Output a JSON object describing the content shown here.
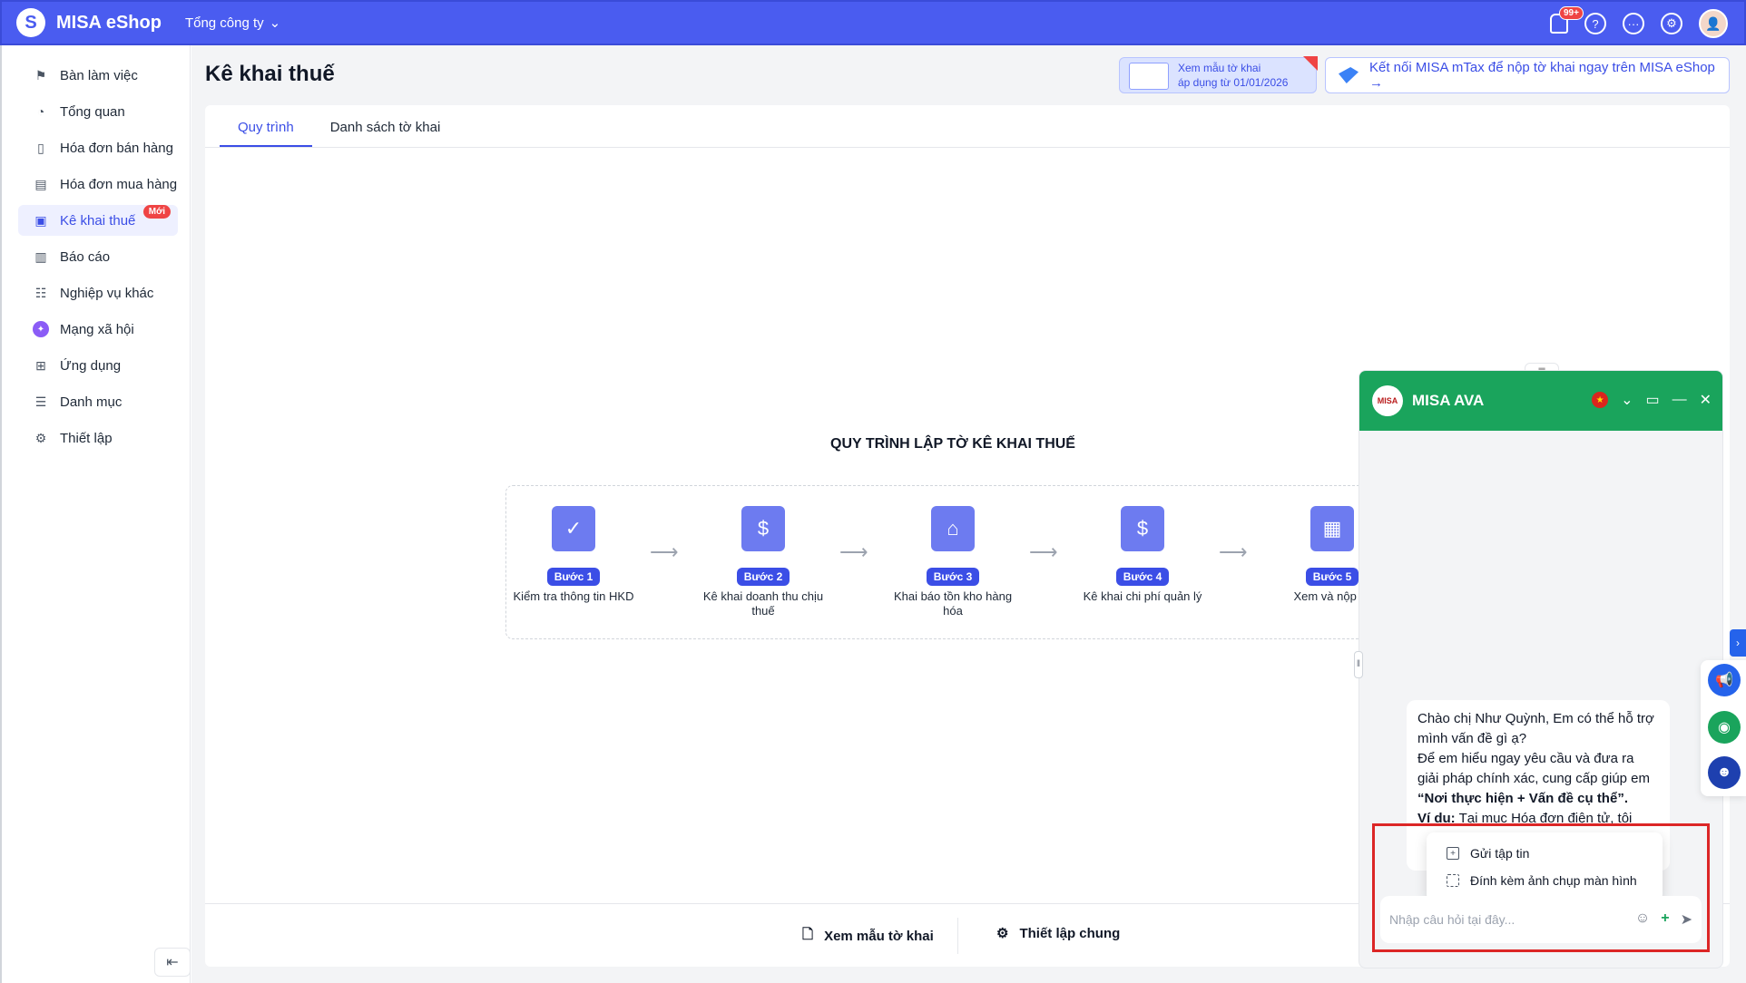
{
  "topbar": {
    "app_name": "MISA eShop",
    "company": "Tổng công ty",
    "notification_count": "99+"
  },
  "sidebar": {
    "items": [
      {
        "label": "Bàn làm việc",
        "icon": "flag-icon"
      },
      {
        "label": "Tổng quan",
        "icon": "gauge-icon"
      },
      {
        "label": "Hóa đơn bán hàng",
        "icon": "document-icon"
      },
      {
        "label": "Hóa đơn mua hàng",
        "icon": "receipt-icon"
      },
      {
        "label": "Kê khai thuế",
        "icon": "tax-document-icon",
        "badge": "Mới"
      },
      {
        "label": "Báo cáo",
        "icon": "bar-chart-icon"
      },
      {
        "label": "Nghiệp vụ khác",
        "icon": "list-grid-icon"
      },
      {
        "label": "Mạng xã hội",
        "icon": "social-icon"
      },
      {
        "label": "Ứng dụng",
        "icon": "apps-icon"
      },
      {
        "label": "Danh mục",
        "icon": "list-icon"
      },
      {
        "label": "Thiết lập",
        "icon": "gear-icon"
      }
    ]
  },
  "page": {
    "title": "Kê khai thuế",
    "promo1_line1": "Xem mẫu tờ khai",
    "promo1_line2": "áp dụng từ 01/01/2026",
    "promo2": "Kết nối MISA mTax để nộp tờ khai ngay trên MISA eShop →"
  },
  "tabs": [
    "Quy trình",
    "Danh sách tờ khai"
  ],
  "process": {
    "title": "QUY TRÌNH LẬP TỜ KÊ KHAI THUẾ",
    "steps": [
      {
        "badge": "Bước 1",
        "label": "Kiểm tra thông tin HKD"
      },
      {
        "badge": "Bước 2",
        "label": "Kê khai doanh thu chịu thuế"
      },
      {
        "badge": "Bước 3",
        "label": "Khai báo tồn kho hàng hóa"
      },
      {
        "badge": "Bước 4",
        "label": "Kê khai chi phí quản lý"
      },
      {
        "badge": "Bước 5",
        "label": "Xem và nộp tờ"
      }
    ]
  },
  "footer": {
    "view_template": "Xem mẫu tờ khai",
    "general_settings": "Thiết lập chung"
  },
  "chat": {
    "title": "MISA AVA",
    "message_line1": "Chào chị Như Quỳnh, Em có thể hỗ trợ mình vấn đề gì ạ?",
    "message_line2": "Để em hiểu ngay yêu cầu và đưa ra giải pháp chính xác, cung cấp giúp em",
    "message_bold": "“Nơi thực hiện + Vấn đề cụ thể”.",
    "example_label": "Ví dụ:",
    "example_text": "Tại mục Hóa đơn điện tử, tôi",
    "input_placeholder": "Nhập câu hỏi tại đây...",
    "attach_file": "Gửi tập tin",
    "attach_screenshot": "Đính kèm ảnh chụp màn hình"
  }
}
